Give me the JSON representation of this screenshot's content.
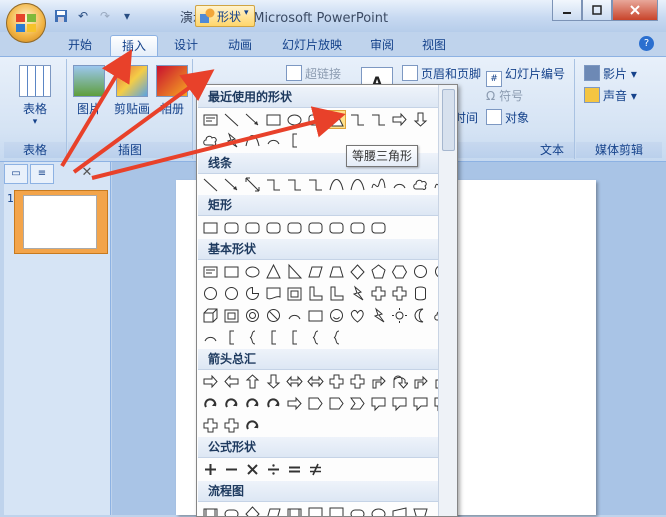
{
  "window": {
    "title": "演示文稿1 - Microsoft PowerPoint"
  },
  "quick_access": {
    "icons": [
      "save-icon",
      "undo-icon",
      "redo-icon",
      "customize-icon"
    ]
  },
  "tabs": [
    {
      "label": "开始"
    },
    {
      "label": "插入"
    },
    {
      "label": "设计"
    },
    {
      "label": "动画"
    },
    {
      "label": "幻灯片放映"
    },
    {
      "label": "审阅"
    },
    {
      "label": "视图"
    }
  ],
  "ribbon": {
    "table": {
      "button": "表格",
      "group": "表格"
    },
    "illustrations": {
      "picture": "图片",
      "clipart": "剪贴画",
      "album": "相册",
      "shapes": "形状",
      "group": "插图"
    },
    "links": {
      "hyperlink": "超链接"
    },
    "text": {
      "header_footer": "页眉和页脚",
      "slide_number": "幻灯片编号",
      "symbol": "符号",
      "datetime": "时间",
      "object": "对象",
      "group": "文本"
    },
    "media": {
      "movie": "影片",
      "sound": "声音",
      "group": "媒体剪辑"
    }
  },
  "gallery": {
    "sections": {
      "recent": "最近使用的形状",
      "lines": "线条",
      "rect": "矩形",
      "basic": "基本形状",
      "arrows": "箭头总汇",
      "equation": "公式形状",
      "flowchart": "流程图"
    },
    "tooltip": "等腰三角形"
  },
  "slides": {
    "number": "1"
  },
  "colors": {
    "accent": "#e8412a",
    "highlight": "#ffe08a",
    "ribbon": "#d5e3f4"
  }
}
